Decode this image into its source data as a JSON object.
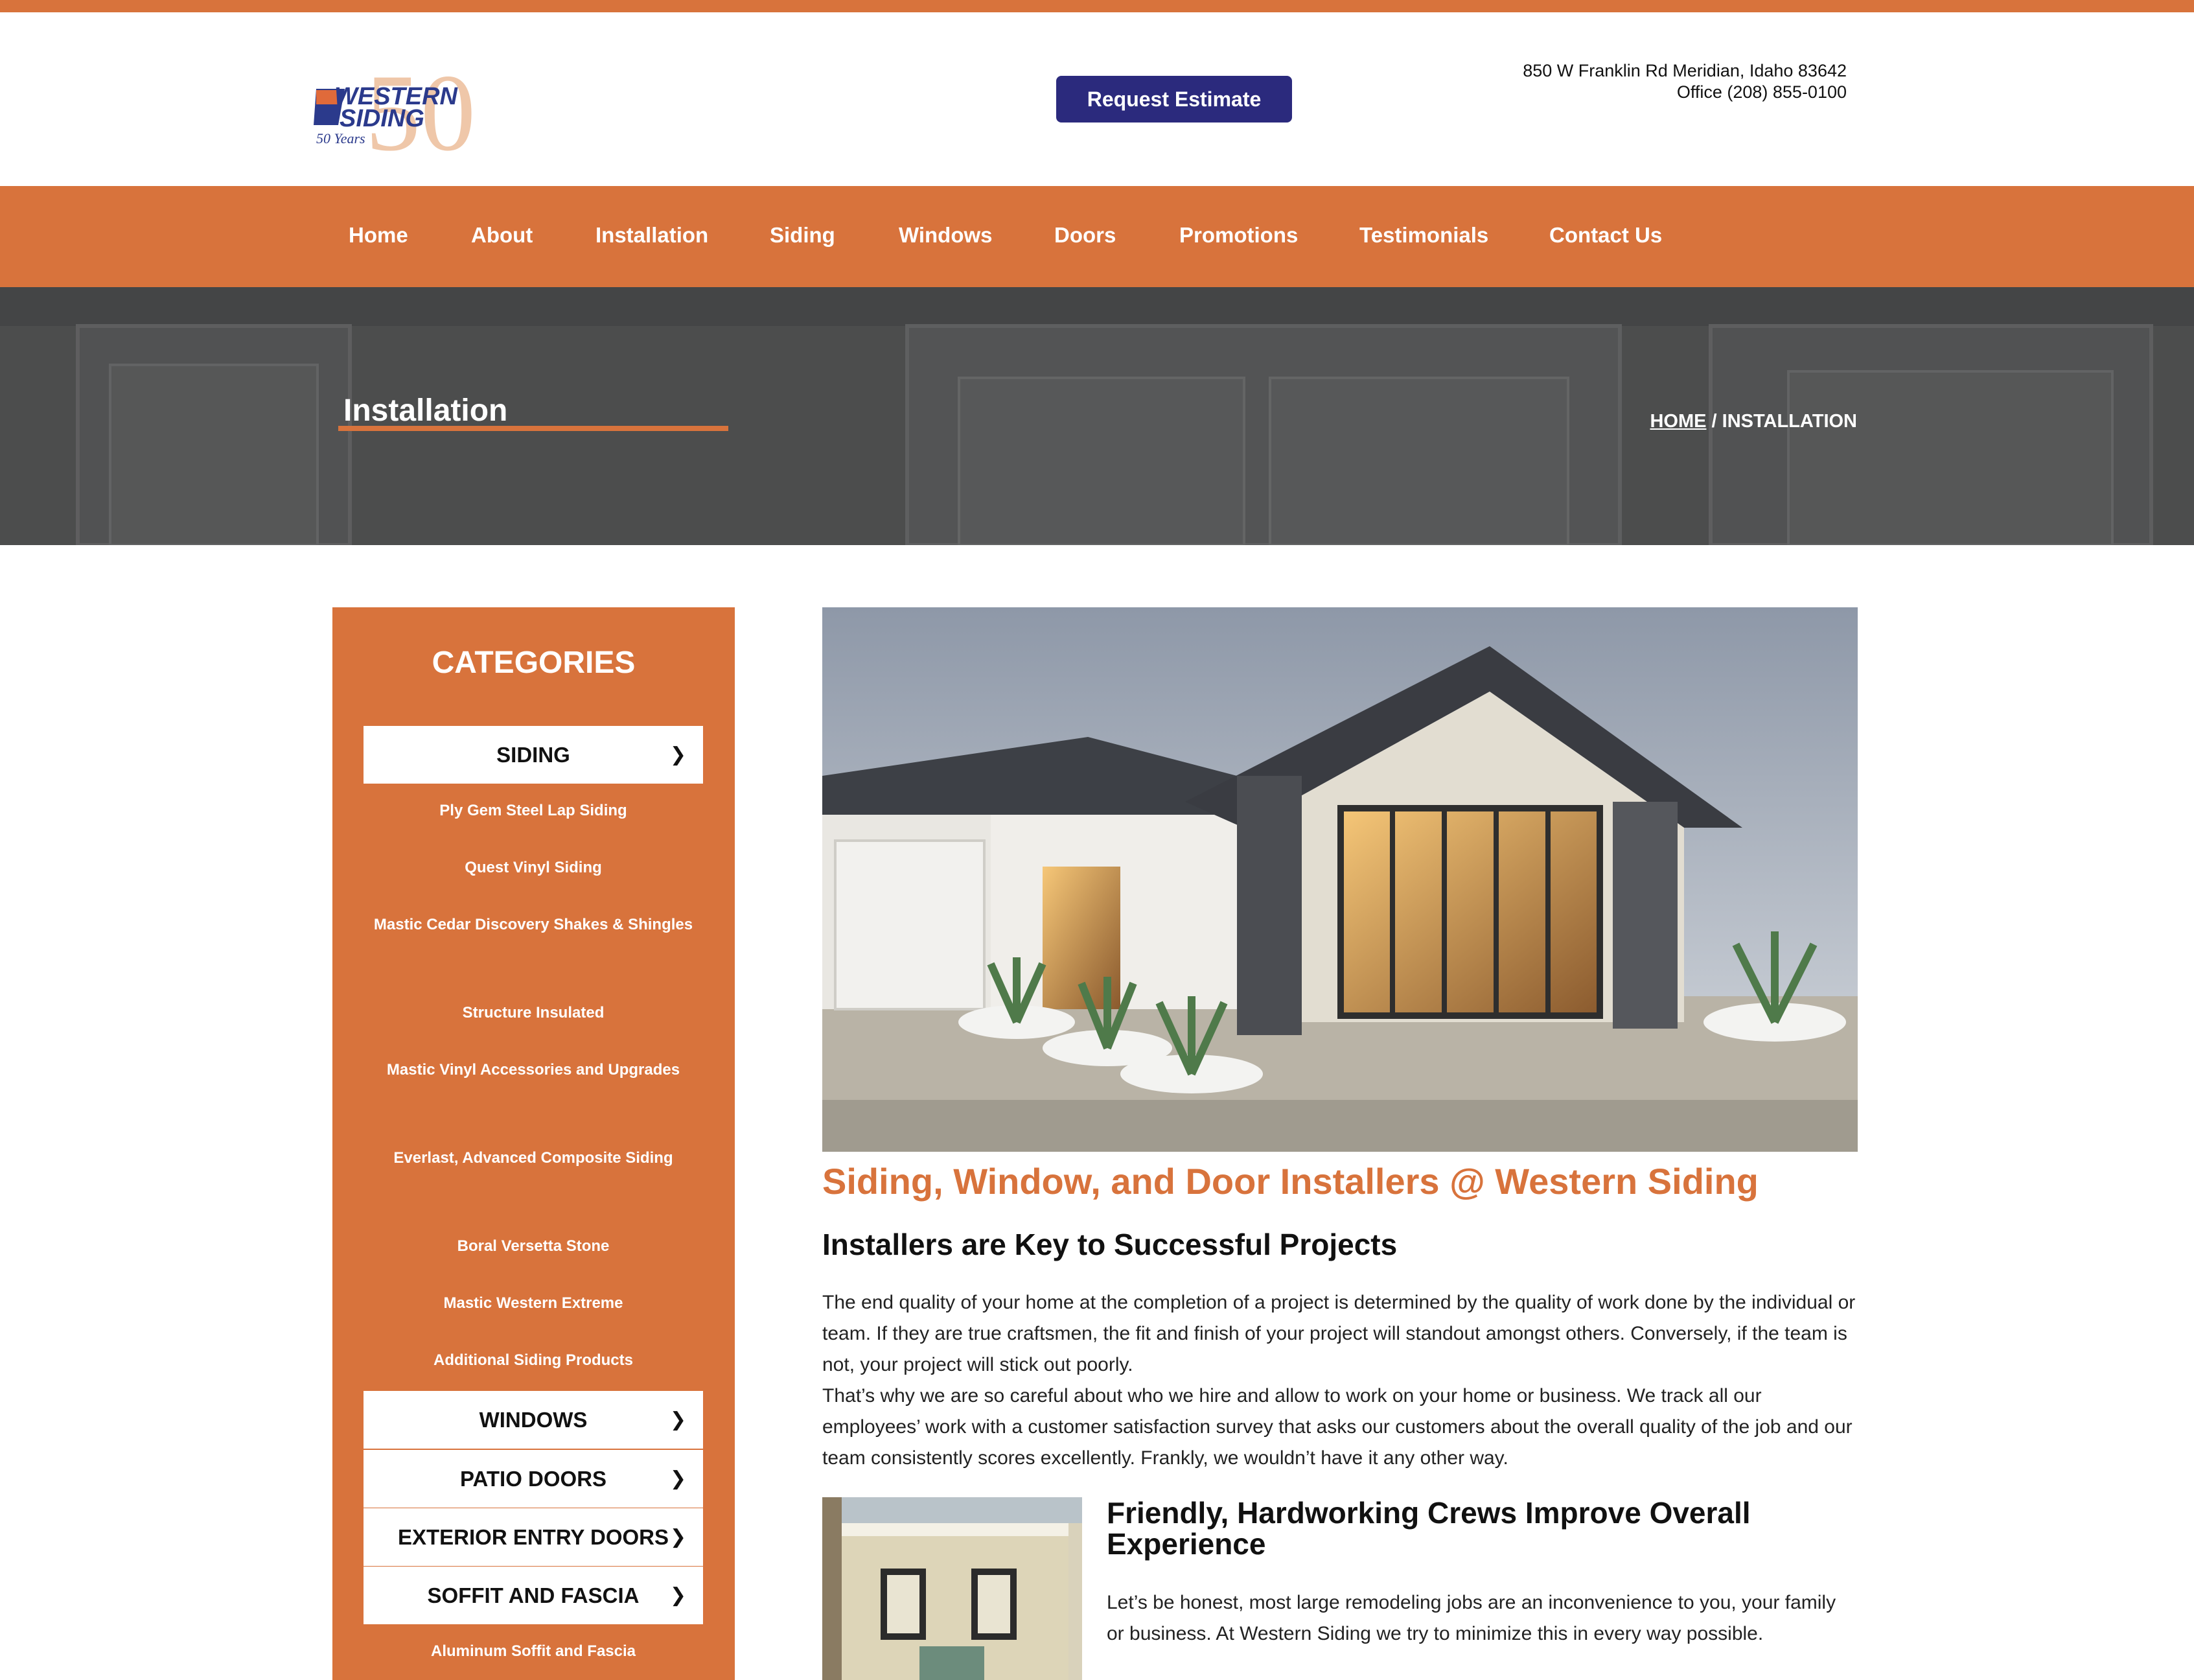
{
  "brand": {
    "logo_text_top": "WESTERN",
    "logo_text_bottom": "SIDING",
    "logo_years": "50 Years",
    "logo_number": "50",
    "accent": "#d8733c",
    "button_color": "#2b2a7d"
  },
  "header": {
    "request_label": "Request Estimate",
    "address": "850 W Franklin Rd Meridian, Idaho 83642",
    "phone": "Office (208) 855-0100"
  },
  "nav": {
    "items": [
      "Home",
      "About",
      "Installation",
      "Siding",
      "Windows",
      "Doors",
      "Promotions",
      "Testimonials",
      "Contact Us"
    ]
  },
  "hero": {
    "title": "Installation",
    "crumb_home": "HOME",
    "crumb_sep": " / ",
    "crumb_current": "INSTALLATION"
  },
  "sidebar": {
    "title": "CATEGORIES",
    "siding_head": "SIDING",
    "siding_items": [
      "Ply Gem Steel Lap Siding",
      "Quest Vinyl Siding",
      "Mastic Cedar Discovery Shakes & Shingles",
      "Structure Insulated",
      "Mastic Vinyl Accessories and Upgrades",
      "Everlast, Advanced Composite Siding",
      "Boral Versetta Stone",
      "Mastic Western Extreme",
      "Additional Siding Products"
    ],
    "windows_head": "WINDOWS",
    "patio_head": "PATIO DOORS",
    "entry_head": "EXTERIOR ENTRY DOORS",
    "soffit_head": "SOFFIT AND FASCIA",
    "soffit_items": [
      "Aluminum Soffit and Fascia"
    ],
    "chevron": "chevron-down-icon"
  },
  "content": {
    "heading": "Siding, Window, and Door Installers @ Western Siding",
    "subheading": "Installers are Key to Successful Projects",
    "para1": "The end quality of your home at the completion of a project is determined by the quality of work done by the individual or team. If they are true craftsmen, the fit and finish of your project will standout amongst others. Conversely, if the team is not, your project will stick out poorly.",
    "para2": "That’s why we are so careful about who we hire and allow to work on your home or business. We track all our employees’ work with a customer satisfaction survey that asks our customers about the overall quality of the job and our team consistently scores excellently. Frankly, we wouldn’t have it any other way.",
    "section2_heading": "Friendly, Hardworking Crews Improve Overall Experience",
    "section2_para": "Let’s be honest, most large remodeling jobs are an inconvenience to you, your family or business. At Western Siding we try to minimize this in every way possible."
  }
}
